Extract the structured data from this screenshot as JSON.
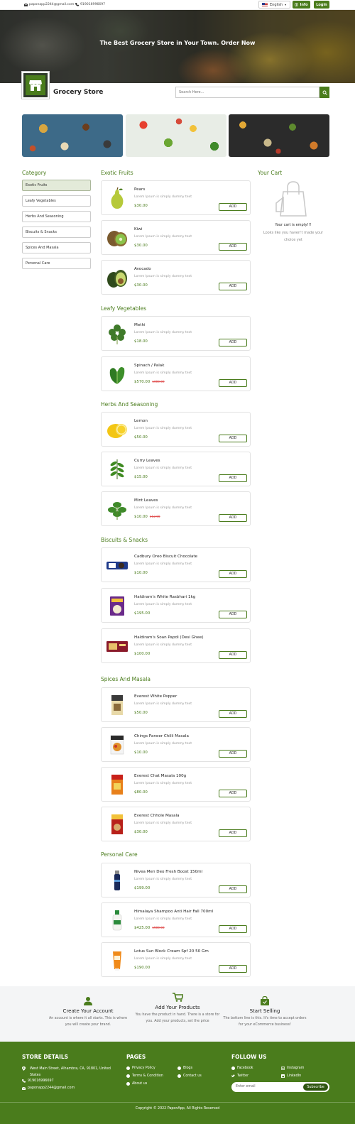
{
  "topbar": {
    "email": "paponapp2244@gmail.com",
    "phone": "919016996697",
    "language": "English",
    "info_label": "Info",
    "login_label": "Login"
  },
  "hero": {
    "headline": "The Best Grocery Store in Your Town. Order Now"
  },
  "header": {
    "store_name": "Grocery Store",
    "search_placeholder": "Search Here..."
  },
  "sidebar": {
    "title": "Category",
    "items": [
      "Exotic Fruits",
      "Leafy Vegetables",
      "Herbs And Seasoning",
      "Biscuits & Snacks",
      "Spices And Masala",
      "Personal Care"
    ],
    "active": "Exotic Fruits"
  },
  "sections": [
    {
      "title": "Exotic Fruits",
      "products": [
        {
          "name": "Pears",
          "desc": "Lorem Ipsum is simply dummy text",
          "price": "$30.00",
          "old": "",
          "icon": "pear-icon"
        },
        {
          "name": "Kiwi",
          "desc": "Lorem Ipsum is simply dummy text",
          "price": "$30.00",
          "old": "",
          "icon": "kiwi-icon"
        },
        {
          "name": "Avocado",
          "desc": "Lorem Ipsum is simply dummy text",
          "price": "$30.00",
          "old": "",
          "icon": "avocado-icon"
        }
      ]
    },
    {
      "title": "Leafy Vegetables",
      "products": [
        {
          "name": "Methi",
          "desc": "Lorem Ipsum is simply dummy text",
          "price": "$18.00",
          "old": "",
          "icon": "methi-icon"
        },
        {
          "name": "Spinach / Palak",
          "desc": "Lorem Ipsum is simply dummy text",
          "price": "$570.00",
          "old": "$600.00",
          "icon": "spinach-icon"
        }
      ]
    },
    {
      "title": "Herbs And Seasoning",
      "products": [
        {
          "name": "Lemon",
          "desc": "Lorem Ipsum is simply dummy text",
          "price": "$50.00",
          "old": "",
          "icon": "lemon-icon"
        },
        {
          "name": "Curry Leaves",
          "desc": "Lorem Ipsum is simply dummy text",
          "price": "$15.00",
          "old": "",
          "icon": "curry-leaves-icon"
        },
        {
          "name": "Mint Leaves",
          "desc": "Lorem Ipsum is simply dummy text",
          "price": "$10.00",
          "old": "$12.00",
          "icon": "mint-icon"
        }
      ]
    },
    {
      "title": "Biscuits & Snacks",
      "products": [
        {
          "name": "Cadbury Oreo Biscuit Chocolate",
          "desc": "Lorem Ipsum is simply dummy text",
          "price": "$10.00",
          "old": "",
          "icon": "oreo-icon"
        },
        {
          "name": "Haldiram's White Rasbhari 1kg",
          "desc": "Lorem Ipsum is simply dummy text",
          "price": "$195.00",
          "old": "",
          "icon": "rasbhari-icon"
        },
        {
          "name": "Haldiram's Soan Papdi (Desi Ghee)",
          "desc": "Lorem Ipsum is simply dummy text",
          "price": "$100.00",
          "old": "",
          "icon": "soan-papdi-icon"
        }
      ]
    },
    {
      "title": "Spices And Masala",
      "products": [
        {
          "name": "Everest White Pepper",
          "desc": "Lorem Ipsum is simply dummy text",
          "price": "$50.00",
          "old": "",
          "icon": "pepper-box-icon"
        },
        {
          "name": "Chings Paneer Chilli Masala",
          "desc": "Lorem Ipsum is simply dummy text",
          "price": "$10.00",
          "old": "",
          "icon": "masala-pack-icon"
        },
        {
          "name": "Everest Chat Masala 100g",
          "desc": "Lorem Ipsum is simply dummy text",
          "price": "$80.00",
          "old": "",
          "icon": "chat-masala-icon"
        },
        {
          "name": "Everest Chhole Masala",
          "desc": "Lorem Ipsum is simply dummy text",
          "price": "$30.00",
          "old": "",
          "icon": "chhole-masala-icon"
        }
      ]
    },
    {
      "title": "Personal Care",
      "products": [
        {
          "name": "Nivea Men Deo Fresh Boost 150ml",
          "desc": "Lorem Ipsum is simply dummy text",
          "price": "$199.00",
          "old": "",
          "icon": "deo-can-icon"
        },
        {
          "name": "Himalaya Shampoo Anti Hair Fall 700ml",
          "desc": "Lorem Ipsum is simply dummy text",
          "price": "$425.00",
          "old": "$500.00",
          "icon": "shampoo-bottle-icon"
        },
        {
          "name": "Lotus Sun Block Cream Spf 20 50 Gm",
          "desc": "Lorem Ipsum is simply dummy text",
          "price": "$190.00",
          "old": "",
          "icon": "sunblock-tube-icon"
        }
      ]
    }
  ],
  "add_label": "ADD",
  "cart": {
    "title": "Your Cart",
    "empty_title": "Your cart is empty!!!",
    "empty_sub": "Looks like you haven't made your choice yet"
  },
  "features": [
    {
      "title": "Create Your Account",
      "text": "An account is where it all starts. This is where you will create your brand.",
      "icon": "user-icon"
    },
    {
      "title": "Add Your Products",
      "text": "You have the product in hand. There is a store for you. Add your products, set the price",
      "icon": "cart-icon"
    },
    {
      "title": "Start Selling",
      "text": "The bottom line is this. It's time to accept orders for your eCommerce business!",
      "icon": "shopping-bag-icon"
    }
  ],
  "footer": {
    "store_title": "STORE DETAILS",
    "address": "West Main Street, Alhambra, CA, 91801, United States",
    "phone": "919016996697",
    "email": "paponapp2244@gmail.com",
    "pages_title": "PAGES",
    "pages": [
      "Privacy Policy",
      "Blogs",
      "Terms & Condition",
      "Contact us",
      "About us"
    ],
    "follow_title": "FOLLOW US",
    "social": [
      "Facebook",
      "Instagram",
      "Twitter",
      "LinkedIn"
    ],
    "email_placeholder": "Enter email",
    "subscribe_label": "Subscribe",
    "copyright": "Copyright © 2022 PaponApp, All Rights Reserved"
  },
  "colors": {
    "accent": "#4a7c1c",
    "footer_bg": "#4a7c1c",
    "sale_price": "#e05050"
  }
}
